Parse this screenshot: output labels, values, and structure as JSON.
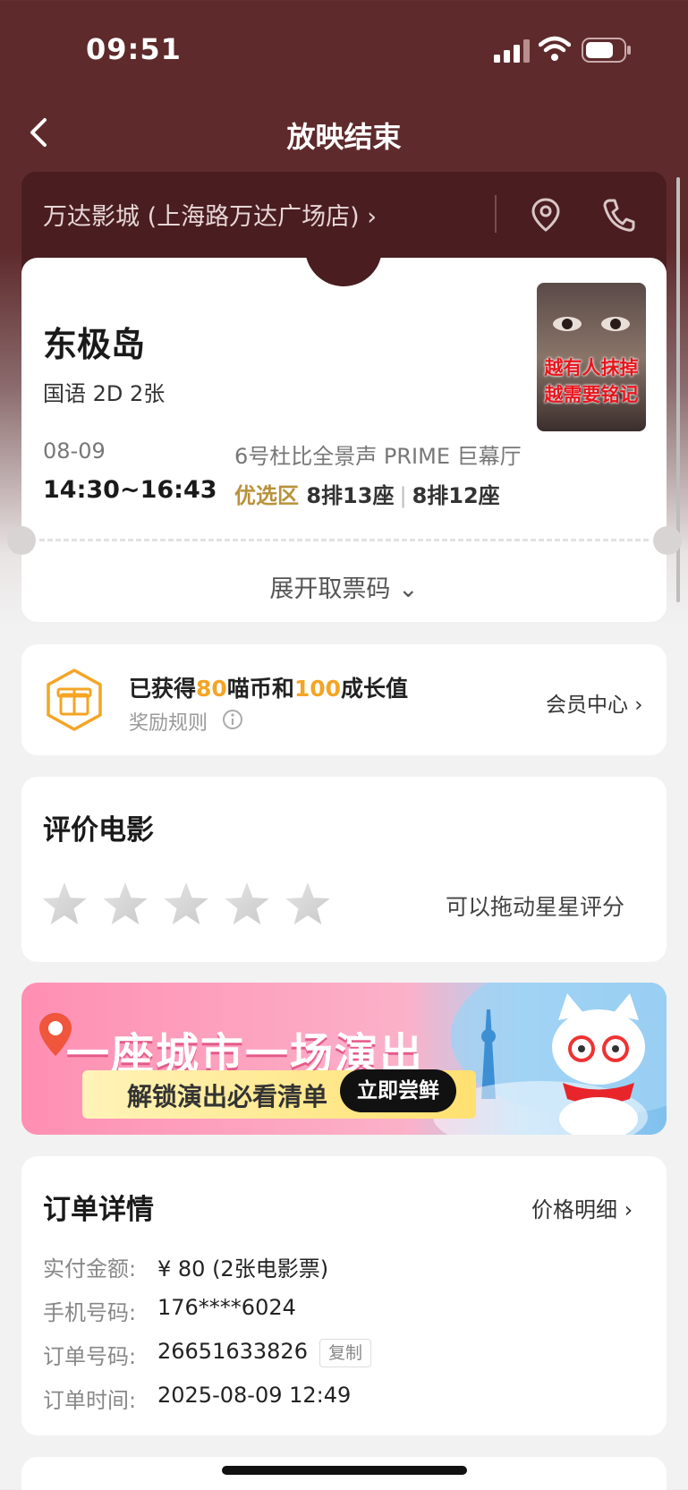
{
  "status_bar": {
    "time": "09:51"
  },
  "nav": {
    "title": "放映结束"
  },
  "cinema": {
    "name": "万达影城 (上海路万达广场店) ›"
  },
  "ticket": {
    "movie_title": "东极岛",
    "meta": "国语 2D 2张",
    "poster_text_line1": "越有人抹掉",
    "poster_text_line2": "越需要铭记",
    "date": "08-09",
    "time_range": "14:30~16:43",
    "hall": "6号杜比全景声 PRIME 巨幕厅",
    "zone": "优选区",
    "seat1": "8排13座",
    "seat_sep": "|",
    "seat2": "8排12座",
    "expand_label": "展开取票码 ⌄"
  },
  "reward": {
    "prefix": "已获得",
    "coins": "80",
    "middle": "喵币和",
    "growth": "100",
    "suffix": "成长值",
    "rules": "奖励规则",
    "member_center": "会员中心 ›"
  },
  "rating": {
    "title": "评价电影",
    "hint": "可以拖动星星评分",
    "stars_total": 5,
    "stars_filled": 0
  },
  "banner": {
    "headline": "一座城市一场演出",
    "sub": "解锁演出必看清单",
    "button": "立即尝鲜"
  },
  "order": {
    "title": "订单详情",
    "price_detail": "价格明细 ›",
    "rows": [
      {
        "label": "实付金额:",
        "value": "¥ 80 (2张电影票)"
      },
      {
        "label": "手机号码:",
        "value": "176****6024"
      },
      {
        "label": "订单号码:",
        "value": "26651633826"
      },
      {
        "label": "订单时间:",
        "value": "2025-08-09 12:49"
      }
    ],
    "copy_label": "复制"
  },
  "colors": {
    "header_bg": "#5e2a2c",
    "accent_gold": "#b8923c",
    "accent_orange": "#f4a524"
  }
}
